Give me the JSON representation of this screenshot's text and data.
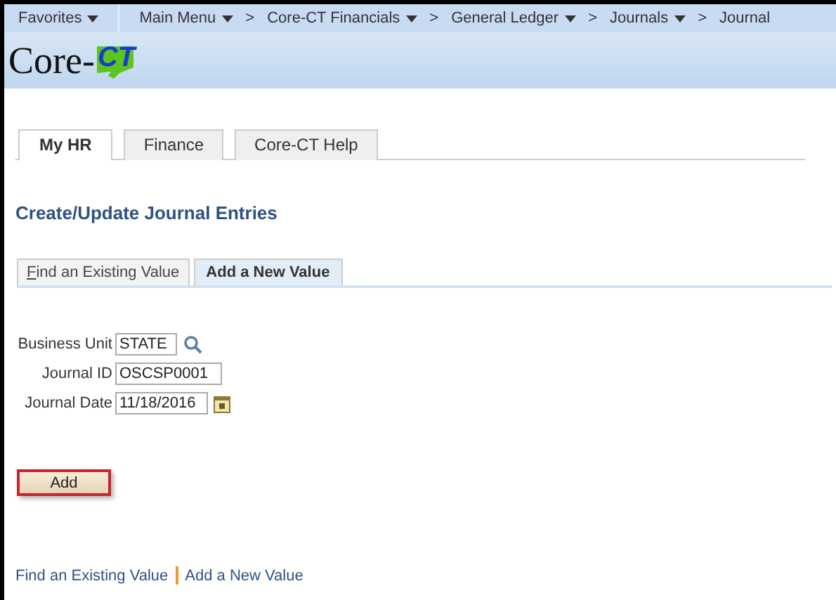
{
  "menu_bar": {
    "items": [
      {
        "label": "Favorites",
        "dropdown": true
      },
      {
        "label": "Main Menu",
        "dropdown": true
      },
      {
        "label": "Core-CT Financials",
        "dropdown": true
      },
      {
        "label": "General Ledger",
        "dropdown": true
      },
      {
        "label": "Journals",
        "dropdown": true
      },
      {
        "label": "Journal",
        "dropdown": false
      }
    ],
    "separator": ">"
  },
  "logo": {
    "text": "Core-",
    "highlight": "CT"
  },
  "tabs": [
    {
      "label": "My HR",
      "selected": true
    },
    {
      "label": "Finance",
      "selected": false
    },
    {
      "label": "Core-CT Help",
      "selected": false
    }
  ],
  "page_title": "Create/Update Journal Entries",
  "sub_tabs": [
    {
      "label": "Find an Existing Value",
      "selected": false
    },
    {
      "label": "Add a New Value",
      "selected": true
    }
  ],
  "form": [
    {
      "label": "Business Unit",
      "value": "STATE",
      "kind": "lookup"
    },
    {
      "label": "Journal ID",
      "value": "OSCSP0001",
      "kind": "text"
    },
    {
      "label": "Journal Date",
      "value": "11/18/2016",
      "kind": "date"
    }
  ],
  "add_button": "Add",
  "footer_links": [
    {
      "label": "Find an Existing Value"
    },
    {
      "label": "Add a New Value"
    }
  ]
}
